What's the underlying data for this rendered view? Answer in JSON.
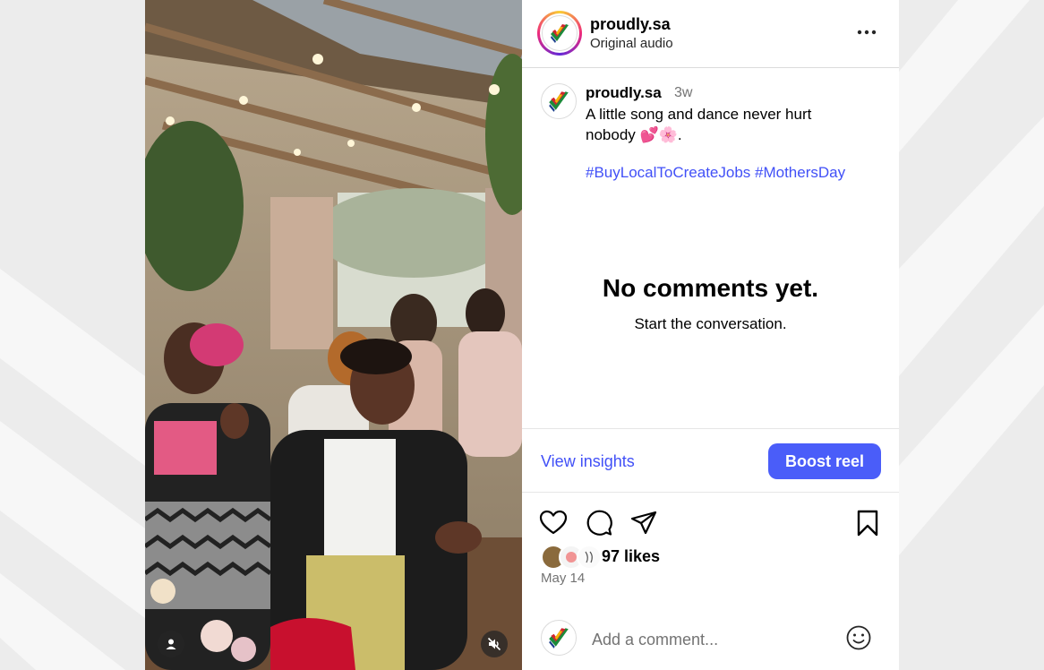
{
  "post": {
    "username": "proudly.sa",
    "audio": "Original audio",
    "caption_username": "proudly.sa",
    "time_ago": "3w",
    "caption_text": "A little song and dance never hurt nobody 💕🌸.",
    "hashtags": [
      "#BuyLocalToCreateJobs",
      "#MothersDay"
    ],
    "likes": "97 likes",
    "date": "May 14"
  },
  "comments": {
    "empty_title": "No comments yet.",
    "empty_subtitle": "Start the conversation."
  },
  "actions": {
    "view_insights": "View insights",
    "boost": "Boost reel"
  },
  "comment_box": {
    "placeholder": "Add a comment..."
  },
  "icons": [
    "more-icon",
    "heart-icon",
    "comment-icon",
    "share-icon",
    "bookmark-icon",
    "smile-icon",
    "person-icon",
    "mute-icon"
  ],
  "colors": {
    "link": "#4150f7",
    "boost_button": "#4a5df9",
    "muted_text": "#737373",
    "divider": "#dbdbdb"
  }
}
